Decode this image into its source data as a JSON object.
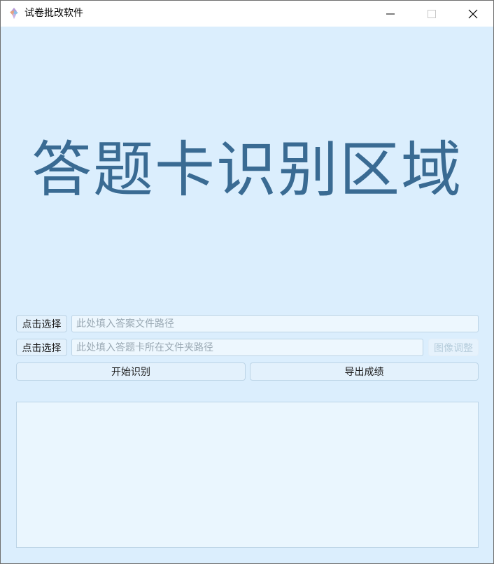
{
  "window": {
    "title": "试卷批改软件",
    "icon": "app-icon"
  },
  "main": {
    "display_title": "答题卡识别区域",
    "answer_row": {
      "select_label": "点击选择",
      "path_placeholder": "此处填入答案文件路径",
      "path_value": ""
    },
    "card_row": {
      "select_label": "点击选择",
      "path_placeholder": "此处填入答题卡所在文件夹路径",
      "path_value": "",
      "adjust_label": "图像调整"
    },
    "actions": {
      "start_label": "开始识别",
      "export_label": "导出成绩"
    },
    "log": {
      "content": ""
    }
  },
  "colors": {
    "background": "#dbeefd",
    "title_text": "#3a6b93",
    "button_bg": "#e3f1fc",
    "border": "#bcd4e6"
  }
}
